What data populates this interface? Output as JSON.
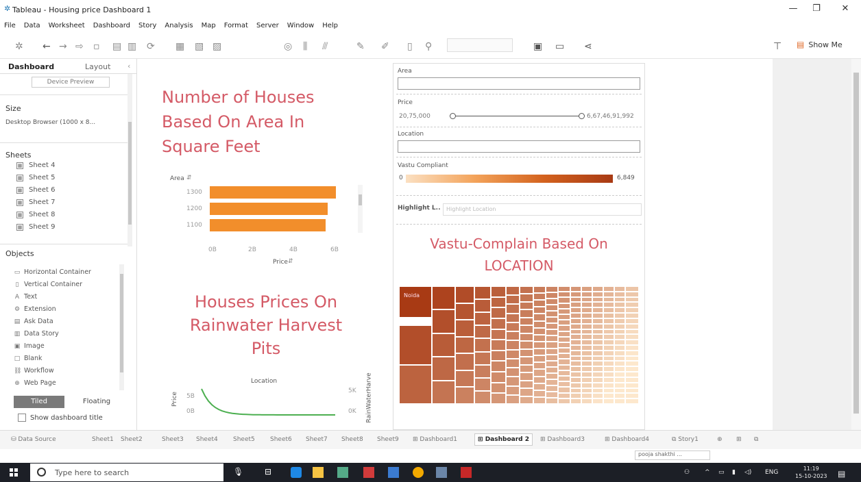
{
  "window": {
    "title": "Tableau - Housing price Dashboard 1",
    "minimize_icon": "minimize-icon",
    "maximize_icon": "maximize-icon",
    "close_icon": "close-icon"
  },
  "menu": [
    "File",
    "Data",
    "Worksheet",
    "Dashboard",
    "Story",
    "Analysis",
    "Map",
    "Format",
    "Server",
    "Window",
    "Help"
  ],
  "toolbar": {
    "show_me": "Show Me"
  },
  "left_panel": {
    "tabs": [
      "Dashboard",
      "Layout"
    ],
    "device_preview": "Device Preview",
    "size_heading": "Size",
    "size_value": "Desktop Browser (1000 x 8...",
    "sheets_heading": "Sheets",
    "sheets": [
      "Sheet 4",
      "Sheet 5",
      "Sheet 6",
      "Sheet 7",
      "Sheet 8",
      "Sheet 9"
    ],
    "objects_heading": "Objects",
    "objects": [
      "Horizontal Container",
      "Vertical Container",
      "Text",
      "Extension",
      "Ask Data",
      "Data Story",
      "Image",
      "Blank",
      "Workflow",
      "Web Page"
    ],
    "tiled": "Tiled",
    "floating": "Floating",
    "show_title": "Show dashboard title"
  },
  "dashboard": {
    "title1_line1": "Number of Houses",
    "title1_line2": "Based On Area In",
    "title1_line3": "Square Feet",
    "title2_line1": "Houses Prices On",
    "title2_line2": "Rainwater Harvest",
    "title2_line3": "Pits",
    "title3_line1": "Vastu-Complain Based On",
    "title3_line2": "LOCATION"
  },
  "chart_data": [
    {
      "type": "bar",
      "orientation": "horizontal",
      "categories": [
        "1300",
        "1200",
        "1100"
      ],
      "values": [
        6.1,
        5.7,
        5.6
      ],
      "ylabel": "Area",
      "xlabel": "Price",
      "xticks": [
        "0B",
        "2B",
        "4B",
        "6B"
      ],
      "xlim": [
        0,
        6.5
      ],
      "color": "#f28e2b"
    },
    {
      "type": "bar",
      "title": "Location",
      "ylabel": "Price",
      "yticks": [
        "0B",
        "5B"
      ],
      "right_label": "RainWaterHarve",
      "right_ticks": [
        "0K",
        "5K"
      ],
      "color": "#4caf50"
    }
  ],
  "filters": {
    "area_label": "Area",
    "price_label": "Price",
    "price_min": "20,75,000",
    "price_max": "6,67,46,91,992",
    "location_label": "Location",
    "vastu_label": "Vastu Compliant",
    "vastu_min": "0",
    "vastu_max": "6,849",
    "highlight_label": "Highlight L..",
    "highlight_placeholder": "Highlight Location"
  },
  "treemap": {
    "first_label": "Noida"
  },
  "tabs": [
    "Data Source",
    "Sheet1",
    "Sheet2",
    "Sheet3",
    "Sheet4",
    "Sheet5",
    "Sheet6",
    "Sheet7",
    "Sheet8",
    "Sheet9",
    "Dashboard1",
    "Dashboard 2",
    "Dashboard3",
    "Dashboard4",
    "Story1"
  ],
  "user": "pooja shakthi ...",
  "taskbar": {
    "search_placeholder": "Type here to search",
    "lang": "ENG",
    "time": "11:19",
    "date": "15-10-2023"
  }
}
